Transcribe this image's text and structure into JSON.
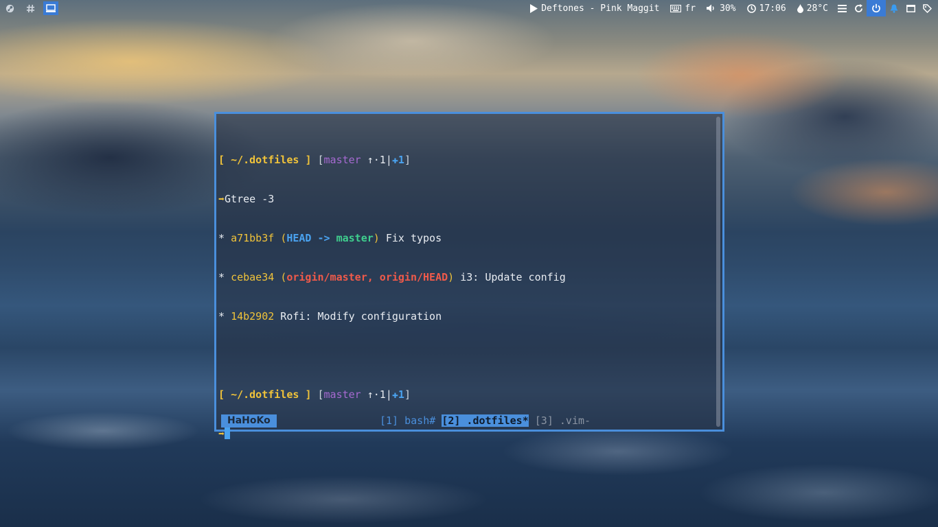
{
  "topbar": {
    "left": {
      "workspace_icons": [
        "steam-icon",
        "hash-icon",
        "monitor-icon"
      ],
      "active_index": 2
    },
    "right": {
      "music": {
        "icon": "play-icon",
        "text": "Deftones - Pink Maggit"
      },
      "keyboard": {
        "icon": "keyboard-icon",
        "text": "fr"
      },
      "volume": {
        "icon": "volume-icon",
        "text": "30%"
      },
      "clock": {
        "icon": "clock-icon",
        "text": "17:06"
      },
      "temperature": {
        "icon": "droplet-icon",
        "text": "28°C"
      },
      "buttons": [
        "menu-icon",
        "refresh-icon",
        "power-icon",
        "bell-icon",
        "window-icon",
        "tag-icon"
      ]
    }
  },
  "terminal": {
    "prompt1": {
      "open": "[",
      "path": "~/.dotfiles",
      "close": "]",
      "bopen": "[",
      "branch": "master",
      "ahead": "↑·1",
      "sep": "|",
      "plus": "✚",
      "count": "1",
      "bclose": "]"
    },
    "cmd_arrow": "➡",
    "command": "Gtree -3",
    "log": [
      {
        "star": "*",
        "hash": "a71bb3f",
        "refs_open": "(",
        "head": "HEAD",
        "arrow": " -> ",
        "branch": "master",
        "refs_close": ")",
        "msg": " Fix typos"
      },
      {
        "star": "*",
        "hash": "cebae34",
        "refs_open": "(",
        "remote": "origin/master, origin/HEAD",
        "refs_close": ")",
        "msg": " i3: Update config"
      },
      {
        "star": "*",
        "hash": "14b2902",
        "msg": " Rofi: Modify configuration"
      }
    ],
    "prompt2": {
      "open": "[",
      "path": "~/.dotfiles",
      "close": "]",
      "bopen": "[",
      "branch": "master",
      "ahead": "↑·1",
      "sep": "|",
      "plus": "✚",
      "count": "1",
      "bclose": "]"
    },
    "prompt2_arrow": "➡"
  },
  "tmux": {
    "session": "HaHoKo",
    "windows": [
      {
        "label": "[1] bash#",
        "state": "normal"
      },
      {
        "label": "[2] .dotfiles*",
        "state": "active"
      },
      {
        "label": "[3] .vim-",
        "state": "inactive"
      }
    ]
  },
  "colors": {
    "accent": "#4a8fdc",
    "prompt_yellow": "#f0c33a",
    "branch_purple": "#a66ad1",
    "head_blue": "#4aa3f0",
    "master_green": "#3fcf8e",
    "remote_red": "#f05a4a"
  }
}
